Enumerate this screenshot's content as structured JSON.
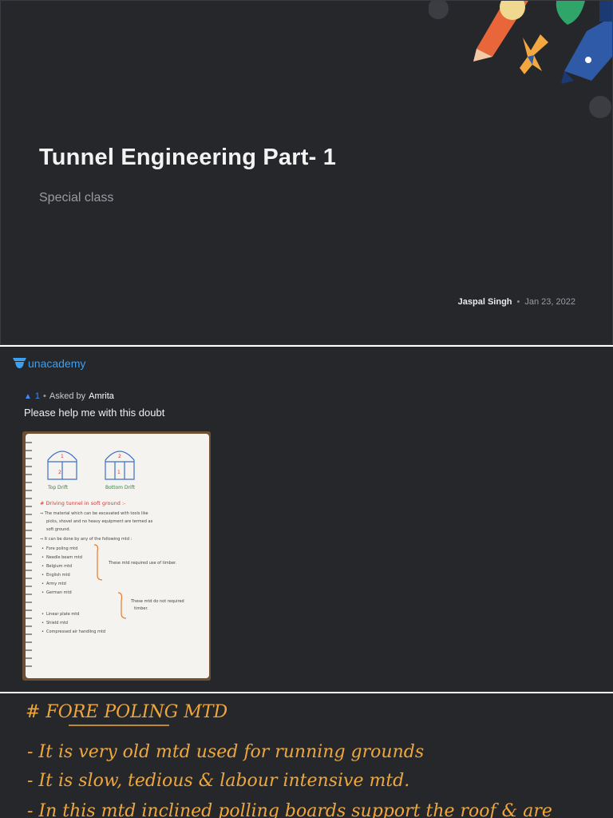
{
  "slide1": {
    "title": "Tunnel Engineering Part- 1",
    "subtitle": "Special class",
    "author": "Jaspal Singh",
    "separator": "•",
    "date": "Jan 23, 2022"
  },
  "slide2": {
    "brand": "unacademy",
    "upvote_count": "1",
    "separator": "•",
    "asked_by_label": "Asked by",
    "asker": "Amrita",
    "question": "Please help me with this doubt",
    "photo": {
      "label_top": "Top Drift",
      "label_bottom": "Bottom Drift",
      "heading": "# Driving tunnel in soft ground :-",
      "line1": "⇒ The material which can be excavated with tools like",
      "line2": "picks, shovel and no heavy equipment are termed as",
      "line3": "soft ground.",
      "line4": "⇒ It can be done by any of the following mtd :",
      "methods": [
        "Fore poling mtd",
        "Needle beam mtd",
        "Belgium mtd",
        "English mtd",
        "Army mtd",
        "German mtd",
        "Linear plate mtd",
        "Shield mtd",
        "Compressed air handling mtd"
      ],
      "note1": "These mtd required use of timber.",
      "note2a": "These mtd do not required",
      "note2b": "timber."
    }
  },
  "slide3": {
    "heading": "# FORE POLING MTD",
    "line1": "- It is very old mtd used for running grounds",
    "line2": "- It is slow, tedious & labour intensive mtd.",
    "line3": "- In this mtd inclined polling boards support the roof & are"
  },
  "colors": {
    "slide_bg": "#26272b",
    "brand_blue": "#3aa0f3",
    "ink_orange": "#f0a73a"
  }
}
